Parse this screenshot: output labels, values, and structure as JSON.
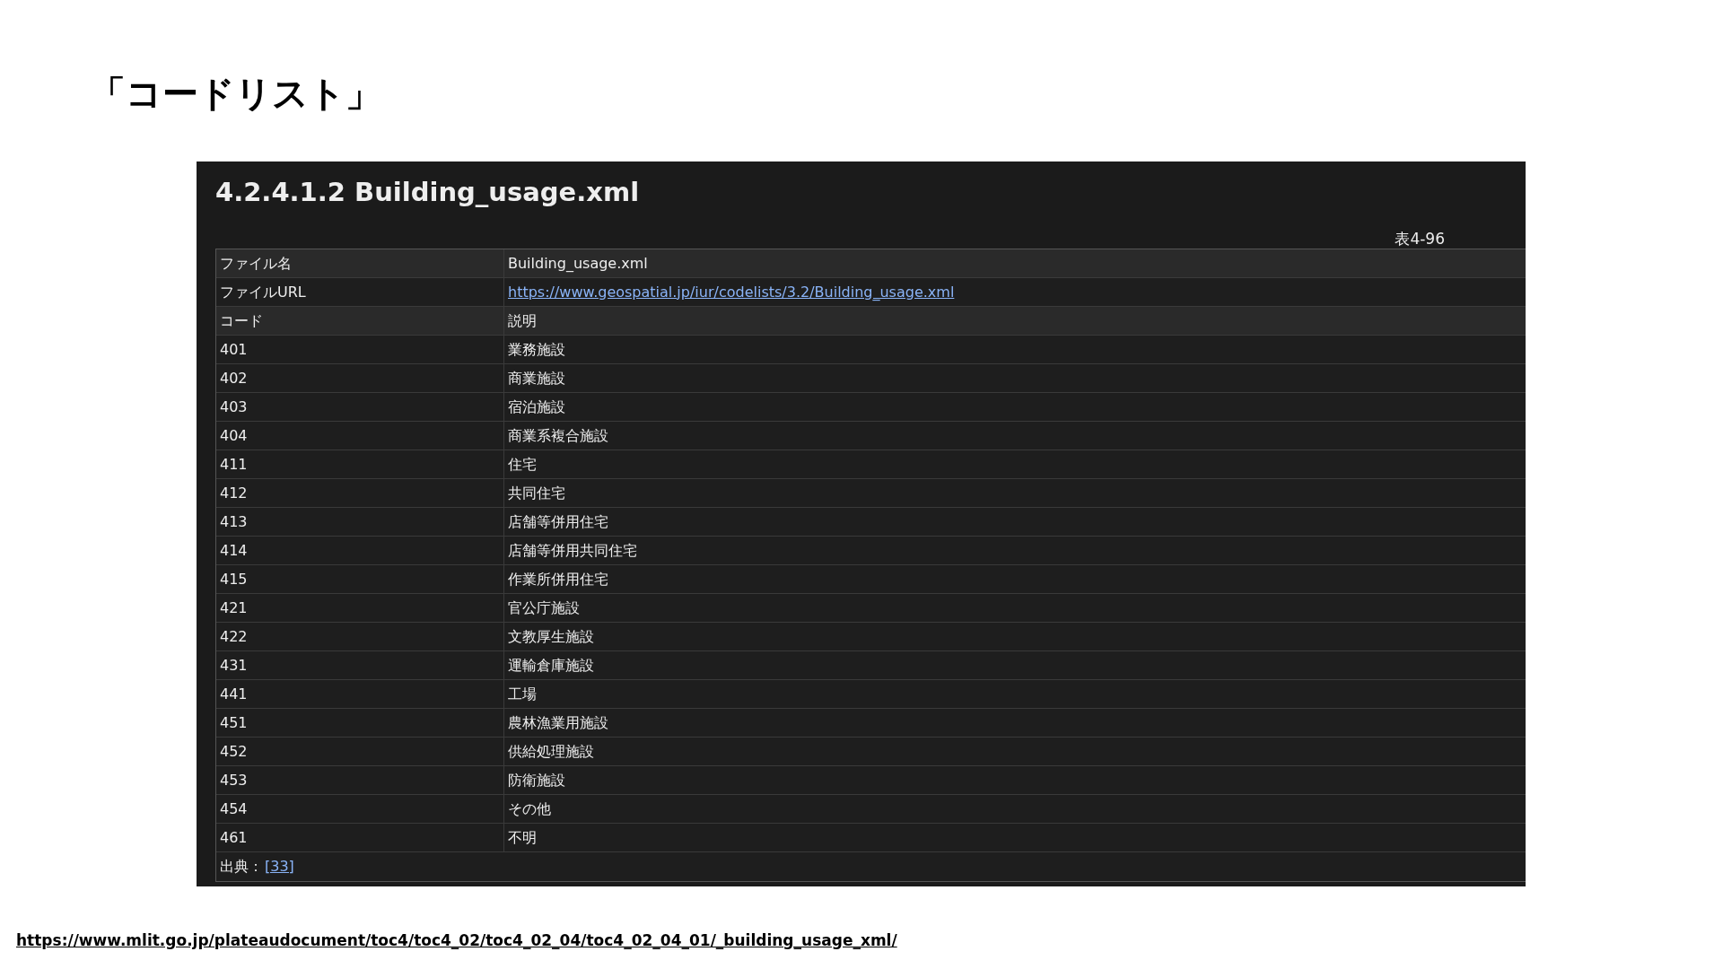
{
  "slide_title": "「コードリスト」",
  "screenshot": {
    "heading": "4.2.4.1.2 Building_usage.xml",
    "caption": "表4-96",
    "file_rows": [
      {
        "kind": "text",
        "label": "ファイル名",
        "value": "Building_usage.xml"
      },
      {
        "kind": "link",
        "label": "ファイルURL",
        "value": "https://www.geospatial.jp/iur/codelists/3.2/Building_usage.xml"
      }
    ],
    "columns": [
      "コード",
      "説明"
    ],
    "rows": [
      [
        "401",
        "業務施設"
      ],
      [
        "402",
        "商業施設"
      ],
      [
        "403",
        "宿泊施設"
      ],
      [
        "404",
        "商業系複合施設"
      ],
      [
        "411",
        "住宅"
      ],
      [
        "412",
        "共同住宅"
      ],
      [
        "413",
        "店舗等併用住宅"
      ],
      [
        "414",
        "店舗等併用共同住宅"
      ],
      [
        "415",
        "作業所併用住宅"
      ],
      [
        "421",
        "官公庁施設"
      ],
      [
        "422",
        "文教厚生施設"
      ],
      [
        "431",
        "運輸倉庫施設"
      ],
      [
        "441",
        "工場"
      ],
      [
        "451",
        "農林漁業用施設"
      ],
      [
        "452",
        "供給処理施設"
      ],
      [
        "453",
        "防衛施設"
      ],
      [
        "454",
        "その他"
      ],
      [
        "461",
        "不明"
      ]
    ],
    "source": {
      "label": "出典：",
      "link": "[33]"
    }
  },
  "source_url": "https://www.mlit.go.jp/plateaudocument/toc4/toc4_02/toc4_02_04/toc4_02_04_01/_building_usage_xml/"
}
